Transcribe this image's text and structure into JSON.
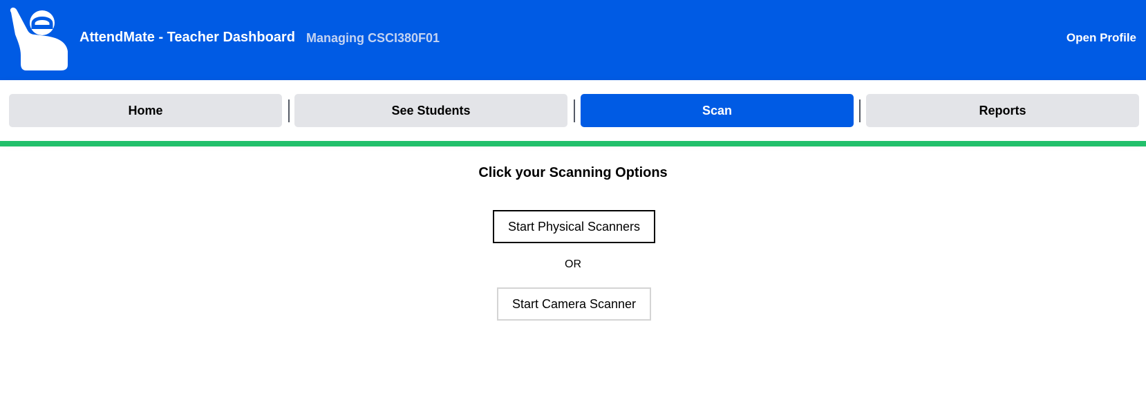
{
  "header": {
    "title": "AttendMate - Teacher Dashboard",
    "course": "Managing CSCI380F01",
    "profile_link": "Open Profile",
    "background_color": "#005be4",
    "logo_icon": "raised-hand-logo-icon"
  },
  "nav": {
    "tabs": [
      {
        "label": "Home",
        "active": false
      },
      {
        "label": "See Students",
        "active": false
      },
      {
        "label": "Scan",
        "active": true
      },
      {
        "label": "Reports",
        "active": false
      }
    ],
    "active_color": "#005be4",
    "inactive_color": "#e3e4e8",
    "accent_bar_color": "#22c06b"
  },
  "main": {
    "heading": "Click your Scanning Options",
    "physical_button": "Start Physical Scanners",
    "or_label": "OR",
    "camera_button": "Start Camera Scanner"
  }
}
